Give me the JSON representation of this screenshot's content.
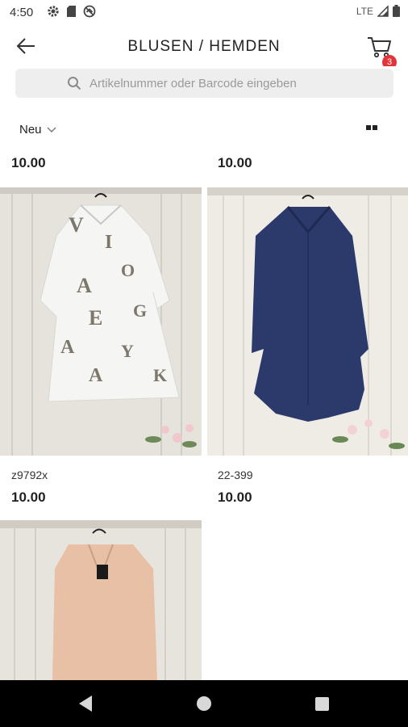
{
  "status": {
    "time": "4:50",
    "network": "LTE"
  },
  "header": {
    "title": "BLUSEN / HEMDEN",
    "cart_count": "3"
  },
  "search": {
    "placeholder": "Artikelnummer oder Barcode eingeben"
  },
  "filter": {
    "sort_label": "Neu"
  },
  "products": [
    {
      "price_above": "10.00"
    },
    {
      "price_above": "10.00"
    },
    {
      "sku": "z9792x",
      "price": "10.00"
    },
    {
      "sku": "22-399",
      "price": "10.00"
    }
  ],
  "colors": {
    "badge": "#e5333a",
    "accent": "#222222"
  },
  "icons": [
    "settings-icon",
    "sd-card-icon",
    "sync-icon",
    "signal-icon",
    "battery-icon",
    "back-arrow-icon",
    "cart-icon",
    "search-icon",
    "chevron-down-icon",
    "grid-view-icon",
    "nav-back-icon",
    "nav-home-icon",
    "nav-recent-icon"
  ]
}
